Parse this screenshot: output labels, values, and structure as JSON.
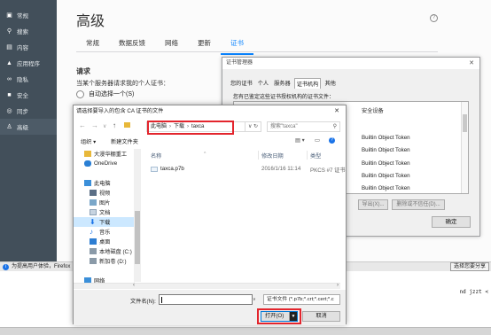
{
  "sidebar": {
    "items": [
      {
        "label": "常规",
        "icon": "gear-icon"
      },
      {
        "label": "搜索",
        "icon": "search-icon"
      },
      {
        "label": "内容",
        "icon": "document-icon"
      },
      {
        "label": "应用程序",
        "icon": "rocket-icon"
      },
      {
        "label": "隐私",
        "icon": "mask-icon"
      },
      {
        "label": "安全",
        "icon": "lock-icon"
      },
      {
        "label": "同步",
        "icon": "sync-icon"
      },
      {
        "label": "高级",
        "icon": "wizard-hat-icon"
      }
    ],
    "active_index": 7
  },
  "main": {
    "title": "高级",
    "tabs": [
      "常规",
      "数据反馈",
      "网络",
      "更新",
      "证书"
    ],
    "active_tab_index": 4,
    "section_title": "请求",
    "section_desc": "当某个服务器请求我的个人证书：",
    "radio_label": "自动选择一个(S)"
  },
  "cert_manager": {
    "title": "证书管理器",
    "tabs": [
      "您的证书",
      "个人",
      "服务器",
      "证书机构",
      "其他"
    ],
    "active_tab_index": 3,
    "description": "您有已鉴定这些证书授权机构的证书文件：",
    "list_rows": [
      "安全设备",
      "Builtin Object Token",
      "Builtin Object Token",
      "Builtin Object Token",
      "Builtin Object Token",
      "Builtin Object Token"
    ],
    "buttons": {
      "export": "导出(X)...",
      "delete": "删除或不信任(D)...",
      "ok": "确定"
    }
  },
  "file_dialog": {
    "title": "请选择要导入的包含 CA 证书的文件",
    "breadcrumb": [
      "此电脑",
      "下载",
      "taxca"
    ],
    "search_placeholder": "搜索\"taxca\"",
    "toolbar": {
      "organize": "组织 ▾",
      "new_folder": "新建文件夹"
    },
    "nav_tree": [
      {
        "label": "大漫华棚重工",
        "icon": "folder-icon"
      },
      {
        "label": "OneDrive",
        "icon": "cloud-icon"
      },
      {
        "label": "",
        "icon": ""
      },
      {
        "label": "此电脑",
        "icon": "computer-icon"
      },
      {
        "label": "视频",
        "icon": "video-icon"
      },
      {
        "label": "图片",
        "icon": "picture-icon"
      },
      {
        "label": "文档",
        "icon": "document-icon"
      },
      {
        "label": "下载",
        "icon": "download-icon"
      },
      {
        "label": "音乐",
        "icon": "music-icon"
      },
      {
        "label": "桌面",
        "icon": "desktop-icon"
      },
      {
        "label": "本地磁盘 (C:)",
        "icon": "drive-icon"
      },
      {
        "label": "新加卷 (D:)",
        "icon": "drive-icon"
      },
      {
        "label": "",
        "icon": ""
      },
      {
        "label": "网络",
        "icon": "network-icon"
      }
    ],
    "selected_tree_index": 7,
    "columns": {
      "name": "名称",
      "modified": "修改日期",
      "type": "类型"
    },
    "files": [
      {
        "name": "taxca.p7b",
        "modified": "2016/1/16 11:14",
        "type": "PKCS #7 证书"
      }
    ],
    "filename_label": "文件名(N):",
    "filename_value": "",
    "filetype": "证书文件 (*.p7b;*.crt;*.cert;*.c",
    "open_label": "打开(O)",
    "cancel_label": "取消"
  },
  "notification": {
    "text": "为提高用户体验，Firefox",
    "button": "选择您要分享"
  },
  "code_text": "nd jzzt <"
}
